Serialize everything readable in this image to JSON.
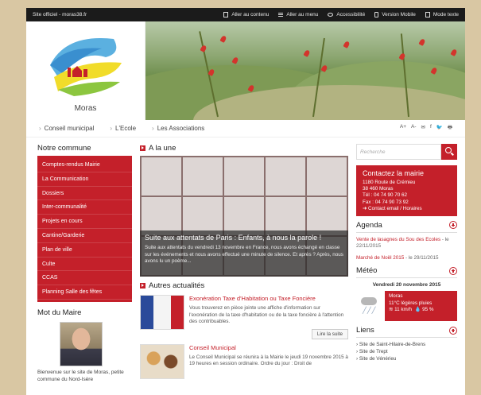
{
  "topbar": {
    "site_label": "Site officiel - moras38.fr",
    "links": [
      {
        "label": "Aller au contenu",
        "icon": "document-icon"
      },
      {
        "label": "Aller au menu",
        "icon": "menu-icon"
      },
      {
        "label": "Accessibilité",
        "icon": "eye-icon"
      },
      {
        "label": "Version Mobile",
        "icon": "phone-icon"
      },
      {
        "label": "Mode texte",
        "icon": "text-icon"
      }
    ]
  },
  "header": {
    "town_name": "Moras"
  },
  "nav": {
    "items": [
      "Conseil municipal",
      "L'Ecole",
      "Les Associations"
    ],
    "tools": [
      "A+",
      "A-",
      "✉",
      "f",
      "🐦",
      "🖶"
    ]
  },
  "left": {
    "title": "Notre commune",
    "menu": [
      "Comptes-rendus Mairie",
      "La Communication",
      "Dossiers",
      "Inter-communalité",
      "Projets en cours",
      "Cantine/Garderie",
      "Plan de ville",
      "Culte",
      "CCAS",
      "Planning Salle des fêtes"
    ],
    "mot_title": "Mot du Maire",
    "mot_text": "Bienvenue sur le site de Moras, petite commune du Nord-Isère"
  },
  "center": {
    "une_title": "A la une",
    "slide": {
      "title": "Suite aux attentats de Paris : Enfants, à nous la parole !",
      "text": "Suite aux attentats du vendredi 13 novembre en France, nous avons échangé en classe sur les événements et nous avons effectué une minute de silence.   Et après ?  Après, nous avons lu un poème..."
    },
    "actu_title": "Autres actualités",
    "news": [
      {
        "title": "Exonération Taxe d'Habitation ou Taxe Foncière",
        "text": "Vous trouverez en pièce jointe une affiche d'information sur l'exonération de la taxe d'habitation ou de la taxe foncière à l'attention des contribuables.",
        "read_more": "Lire la suite"
      },
      {
        "title": "Conseil Municipal",
        "text": "Le Conseil Municipal se réunira à la Mairie le jeudi 19 novembre 2015 à 19 heures en session ordinaire.  Ordre du jour : Droit de"
      }
    ]
  },
  "right": {
    "search_placeholder": "Recherche",
    "contact": {
      "title": "Contactez la mairie",
      "lines": [
        "1180 Route de Crémieu",
        "38 460 Moras",
        "Tél : 04 74 90 70 62",
        "Fax : 04 74 90 73 92"
      ],
      "link": "➜ Contact email / Horaires"
    },
    "agenda_title": "Agenda",
    "agenda": [
      {
        "label": "Vente de lasagnes du Sou des Ecoles",
        "date": " - le 22/11/2015"
      },
      {
        "label": "Marché de Noël 2015",
        "date": " - le 29/11/2015"
      }
    ],
    "meteo_title": "Météo",
    "meteo": {
      "date": "Vendredi 20 novembre 2015",
      "place": "Moras",
      "desc": "11°C légères pluies",
      "wind": "11 km/h",
      "humidity": "95 %"
    },
    "liens_title": "Liens",
    "liens": [
      "› Site de Saint-Hilaire-de-Brens",
      "› Site de Trept",
      "› Site de Vénérieu"
    ]
  },
  "colors": {
    "accent": "#c4202a",
    "topbar": "#1b1b1b",
    "page_bg": "#d9c7a3"
  }
}
